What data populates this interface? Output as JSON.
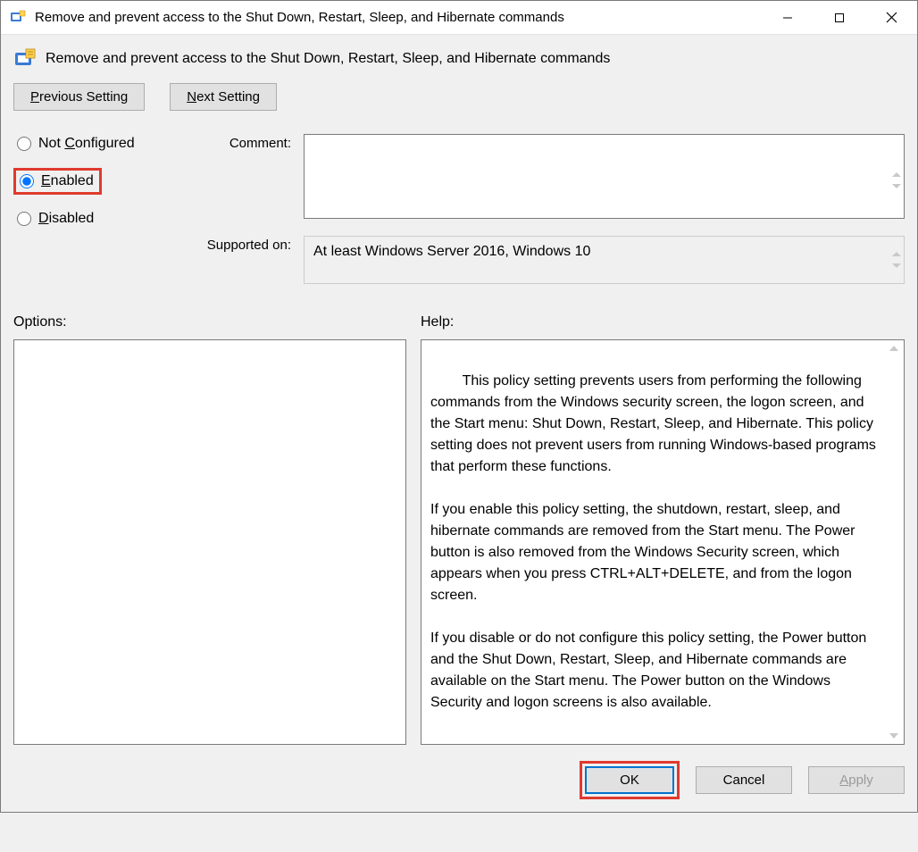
{
  "window": {
    "title": "Remove and prevent access to the Shut Down, Restart, Sleep, and Hibernate commands"
  },
  "policy": {
    "title": "Remove and prevent access to the Shut Down, Restart, Sleep, and Hibernate commands"
  },
  "nav": {
    "previous_label": "Previous Setting",
    "next_label": "Next Setting"
  },
  "state": {
    "not_configured_label": "Not Configured",
    "enabled_label": "Enabled",
    "disabled_label": "Disabled",
    "selected": "enabled"
  },
  "fields": {
    "comment_label": "Comment:",
    "comment_value": "",
    "supported_label": "Supported on:",
    "supported_value": "At least Windows Server 2016, Windows 10"
  },
  "sections": {
    "options_label": "Options:",
    "help_label": "Help:"
  },
  "help_text": "This policy setting prevents users from performing the following commands from the Windows security screen, the logon screen, and the Start menu: Shut Down, Restart, Sleep, and Hibernate. This policy setting does not prevent users from running Windows-based programs that perform these functions.\n\nIf you enable this policy setting, the shutdown, restart, sleep, and hibernate commands are removed from the Start menu. The Power button is also removed from the Windows Security screen, which appears when you press CTRL+ALT+DELETE, and from the logon screen.\n\nIf you disable or do not configure this policy setting, the Power button and the Shut Down, Restart, Sleep, and Hibernate commands are available on the Start menu. The Power button on the Windows Security and logon screens is also available.",
  "footer": {
    "ok_label": "OK",
    "cancel_label": "Cancel",
    "apply_label": "Apply"
  }
}
